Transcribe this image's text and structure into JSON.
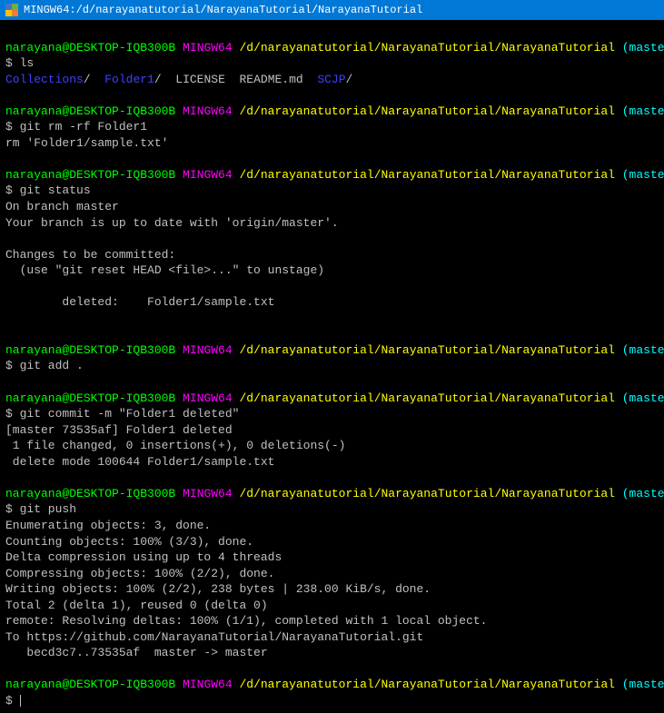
{
  "titlebar": {
    "text": "MINGW64:/d/narayanatutorial/NarayanaTutorial/NarayanaTutorial"
  },
  "prompt": {
    "user": "narayana@DESKTOP-IQB300B",
    "env": "MINGW64",
    "path": "/d/narayanatutorial/NarayanaTutorial/NarayanaTutorial",
    "branch": "(master)"
  },
  "blocks": [
    {
      "cmd": "$ ls",
      "ls_output": [
        {
          "name": "Collections",
          "type": "dir"
        },
        {
          "name": "Folder1",
          "type": "dir"
        },
        {
          "name": "LICENSE",
          "type": "file"
        },
        {
          "name": "README.md",
          "type": "file"
        },
        {
          "name": "SCJP",
          "type": "dir"
        }
      ]
    },
    {
      "cmd": "$ git rm -rf Folder1",
      "output": [
        "rm 'Folder1/sample.txt'"
      ]
    },
    {
      "cmd": "$ git status",
      "output": [
        "On branch master",
        "Your branch is up to date with 'origin/master'.",
        "",
        "Changes to be committed:",
        "  (use \"git reset HEAD <file>...\" to unstage)",
        ""
      ],
      "staged": "        deleted:    Folder1/sample.txt",
      "after_staged": [
        ""
      ]
    },
    {
      "cmd": "$ git add ."
    },
    {
      "cmd": "$ git commit -m \"Folder1 deleted\"",
      "output": [
        "[master 73535af] Folder1 deleted",
        " 1 file changed, 0 insertions(+), 0 deletions(-)",
        " delete mode 100644 Folder1/sample.txt"
      ]
    },
    {
      "cmd": "$ git push",
      "output": [
        "Enumerating objects: 3, done.",
        "Counting objects: 100% (3/3), done.",
        "Delta compression using up to 4 threads",
        "Compressing objects: 100% (2/2), done.",
        "Writing objects: 100% (2/2), 238 bytes | 238.00 KiB/s, done.",
        "Total 2 (delta 1), reused 0 (delta 0)",
        "remote: Resolving deltas: 100% (1/1), completed with 1 local object.",
        "To https://github.com/NarayanaTutorial/NarayanaTutorial.git",
        "   becd3c7..73535af  master -> master"
      ]
    },
    {
      "cmd": "$ ",
      "cursor": true
    }
  ]
}
